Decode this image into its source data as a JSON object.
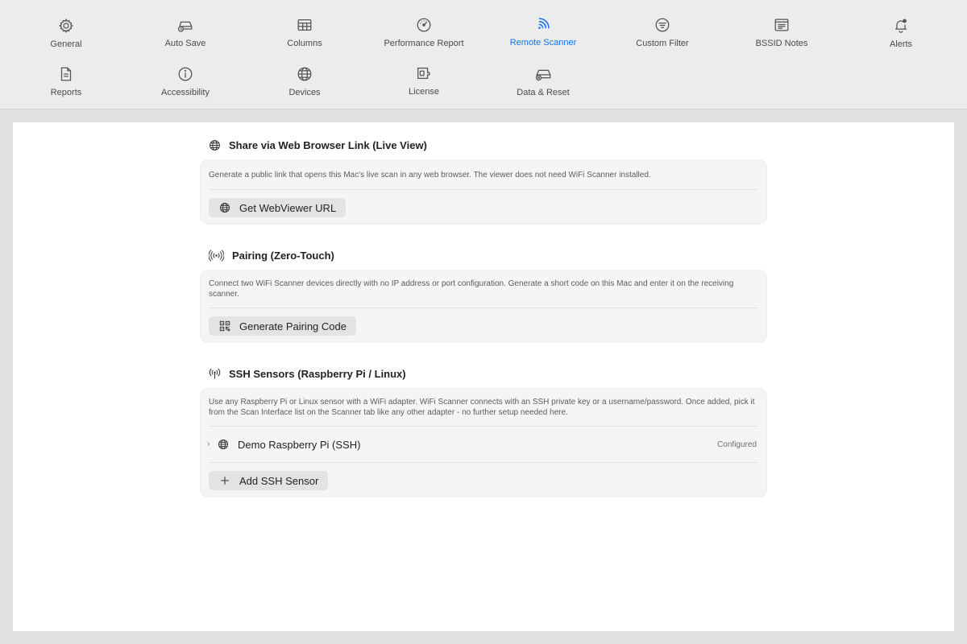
{
  "toolbar": {
    "tabs": [
      {
        "label": "General",
        "icon": "gear-icon"
      },
      {
        "label": "Auto Save",
        "icon": "drive-clock-icon"
      },
      {
        "label": "Columns",
        "icon": "table-icon"
      },
      {
        "label": "Performance Report",
        "icon": "gauge-icon"
      },
      {
        "label": "Remote Scanner",
        "icon": "wifi-signal-icon",
        "active": true
      },
      {
        "label": "Custom Filter",
        "icon": "filter-icon"
      },
      {
        "label": "BSSID Notes",
        "icon": "notes-icon"
      },
      {
        "label": "Alerts",
        "icon": "bell-icon"
      },
      {
        "label": "Reports",
        "icon": "document-icon"
      },
      {
        "label": "Accessibility",
        "icon": "accessibility-icon"
      },
      {
        "label": "Devices",
        "icon": "globe-icon"
      },
      {
        "label": "License",
        "icon": "license-icon"
      },
      {
        "label": "Data & Reset",
        "icon": "drive-reset-icon"
      }
    ],
    "accent_color": "#1a73e8"
  },
  "web_share": {
    "title": "Share via Web Browser Link (Live View)",
    "description": "Generate a public link that opens this Mac's live scan in any web browser. The viewer does not need WiFi Scanner installed.",
    "button_label": "Get WebViewer URL"
  },
  "pairing": {
    "title": "Pairing (Zero-Touch)",
    "description": "Connect two WiFi Scanner devices directly with no IP address or port configuration. Generate a short code on this Mac and enter it on the receiving scanner.",
    "button_label": "Generate Pairing Code"
  },
  "ssh": {
    "title": "SSH Sensors (Raspberry Pi / Linux)",
    "description": "Use any Raspberry Pi or Linux sensor with a WiFi adapter. WiFi Scanner connects with an SSH private key or a username/password. Once added, pick it from the Scan Interface list on the Scanner tab like any other adapter - no further setup needed here.",
    "sensor_name": "Demo Raspberry Pi (SSH)",
    "sensor_status": "Configured",
    "add_button_label": "Add SSH Sensor"
  }
}
